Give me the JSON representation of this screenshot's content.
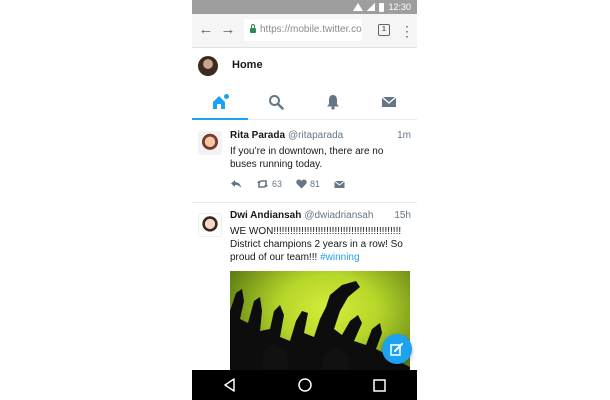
{
  "status_bar": {
    "time": "12:30"
  },
  "browser": {
    "url": "https://mobile.twitter.com",
    "tab_count": "1"
  },
  "header": {
    "title": "Home"
  },
  "tabs": [
    {
      "icon": "home-icon",
      "active": true
    },
    {
      "icon": "search-icon",
      "active": false
    },
    {
      "icon": "notifications-bell-icon",
      "active": false
    },
    {
      "icon": "messages-envelope-icon",
      "active": false
    }
  ],
  "tweets": [
    {
      "name": "Rita Parada",
      "handle": "@ritaparada",
      "time": "1m",
      "text": "If you’re in downtown, there are no buses running today.",
      "retweets": "63",
      "likes": "81"
    },
    {
      "name": "Dwi Andiansah",
      "handle": "@dwiadriansah",
      "time": "15h",
      "text_line1": "WE WON!!!!!!!!!!!!!!!!!!!!!!!!!!!!!!!!!!!!!!!!!!!!!!",
      "text_line2": "District champions 2 years in a row! So proud of our team!!! ",
      "hashtag": "#winning"
    }
  ],
  "colors": {
    "accent": "#1da1f2",
    "secure": "#2e8b57"
  }
}
